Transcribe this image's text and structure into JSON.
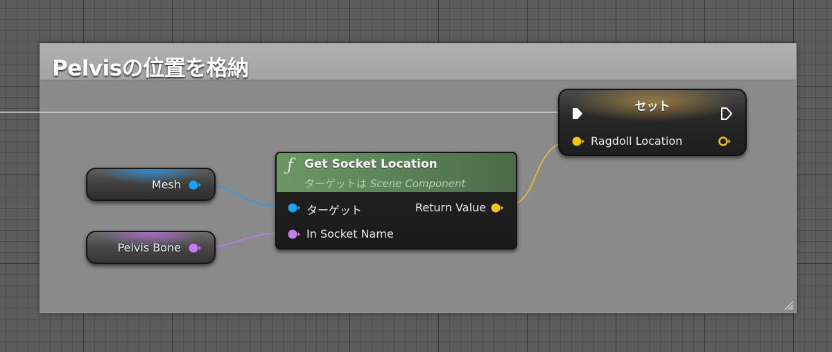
{
  "comment": {
    "title": "Pelvisの位置を格納"
  },
  "variables": {
    "mesh": {
      "label": "Mesh",
      "pin_color": "#1aa3f0"
    },
    "pelvis_bone": {
      "label": "Pelvis Bone",
      "pin_color": "#c77bf0"
    }
  },
  "function_node": {
    "icon": "function-icon",
    "title": "Get Socket Location",
    "subtitle_prefix": "ターゲットは ",
    "subtitle_class": "Scene Component",
    "header_color": "#5f8759",
    "inputs": {
      "target": "ターゲット",
      "socket_name": "In Socket Name"
    },
    "outputs": {
      "return_value": "Return Value"
    }
  },
  "set_node": {
    "title": "セット",
    "input_label": "Ragdoll Location",
    "vector_color": "#f2c319"
  },
  "wire_colors": {
    "exec": "#d8d8d8",
    "object": "#1aa3f0",
    "name": "#c77bf0",
    "vector": "#f2c319"
  }
}
